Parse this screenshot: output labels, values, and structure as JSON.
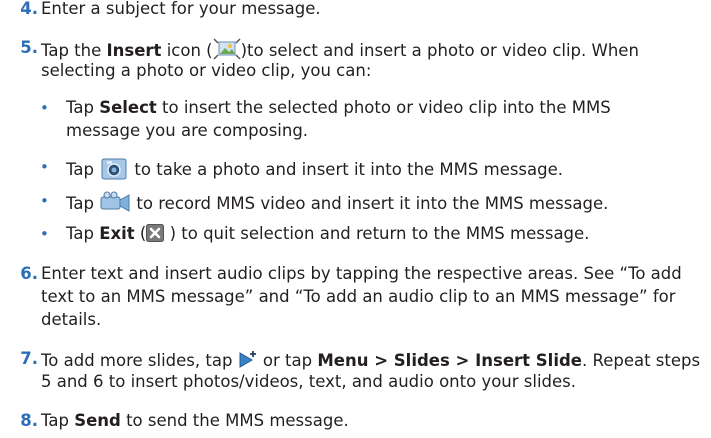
{
  "steps": {
    "s4": {
      "num": "4.",
      "text": "Enter a subject for your message."
    },
    "s5": {
      "num": "5.",
      "tap": "Tap the ",
      "insert_bold": "Insert",
      "icon_open": " icon (",
      "after_icon": ")to select and insert a photo or video clip. When",
      "line2": "selecting a photo or video clip, you can:",
      "bullets": {
        "b1": {
          "tap": "Tap ",
          "bold": "Select",
          "rest": " to insert the selected photo or video clip into the MMS",
          "line2": "message you are composing."
        },
        "b2": {
          "tap": "Tap ",
          "rest": " to take a photo and insert it into the MMS message."
        },
        "b3": {
          "tap": "Tap ",
          "rest": " to record MMS video and insert it into the MMS message."
        },
        "b4": {
          "tap": "Tap ",
          "bold": "Exit",
          "open": " (",
          "close": " ) to quit selection and return to the MMS message."
        }
      }
    },
    "s6": {
      "num": "6.",
      "line1": "Enter text and insert audio clips by tapping the respective areas. See “To add",
      "line2": "text to an MMS message” and “To add an audio clip to an MMS message” for",
      "line3": "details."
    },
    "s7": {
      "num": "7.",
      "pre": "To add more slides, tap ",
      "mid": " or tap ",
      "menu_path": "Menu > Slides > Insert Slide",
      "post": ". Repeat steps",
      "line2": "5 and 6 to insert photos/videos, text, and audio onto your slides."
    },
    "s8": {
      "num": "8.",
      "tap": "Tap ",
      "bold": "Send",
      "rest": " to send the MMS message."
    }
  },
  "bullet_char": "•",
  "colors": {
    "number": "#2d6fb7",
    "text": "#231f20",
    "exit_icon_bg": "#7a7a7a"
  },
  "icons": [
    "insert-media-icon",
    "camera-icon",
    "video-camera-icon",
    "exit-x-icon",
    "insert-slide-icon"
  ]
}
